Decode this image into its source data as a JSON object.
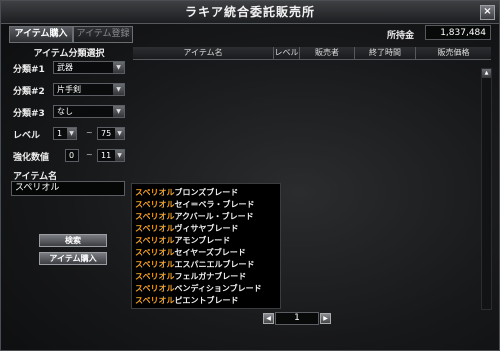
{
  "window": {
    "title": "ラキア統合委託販売所",
    "close": "×"
  },
  "tabs": [
    {
      "label": "アイテム購入"
    },
    {
      "label": "アイテム登録"
    }
  ],
  "gold": {
    "label": "所持金",
    "value": "1,837,484"
  },
  "filter": {
    "title": "アイテム分類選択",
    "cat1": {
      "label": "分類#1",
      "value": "武器"
    },
    "cat2": {
      "label": "分類#2",
      "value": "片手剣"
    },
    "cat3": {
      "label": "分類#3",
      "value": "なし"
    },
    "level": {
      "label": "レベル",
      "min": "1",
      "max": "75",
      "sep": "~"
    },
    "enhance": {
      "label": "強化数値",
      "min": "0",
      "max": "11",
      "sep": "~"
    },
    "name_label": "アイテム名",
    "name_value": "スペリオル"
  },
  "buttons": {
    "search": "検索",
    "buy": "アイテム購入"
  },
  "table": {
    "headers": [
      "アイテム名",
      "レベル",
      "販売者",
      "終了時間",
      "販売価格"
    ]
  },
  "suggestions": [
    {
      "prefix": "スペリオル",
      "rest": "ブロンズブレード"
    },
    {
      "prefix": "スペリオル",
      "rest": "セイ＝ベラ・ブレード"
    },
    {
      "prefix": "スペリオル",
      "rest": "アクバール・ブレード"
    },
    {
      "prefix": "スペリオル",
      "rest": "ヴィサヤブレード"
    },
    {
      "prefix": "スペリオル",
      "rest": "アモンブレード"
    },
    {
      "prefix": "スペリオル",
      "rest": "セイヤーズブレード"
    },
    {
      "prefix": "スペリオル",
      "rest": "エスパニエルブレード"
    },
    {
      "prefix": "スペリオル",
      "rest": "フェルガナブレード"
    },
    {
      "prefix": "スペリオル",
      "rest": "ベンディションブレード"
    },
    {
      "prefix": "スペリオル",
      "rest": "ピエントブレード"
    }
  ],
  "pager": {
    "page": "1",
    "prev": "◀",
    "next": "▶"
  },
  "icons": {
    "dropdown": "▼",
    "scroll_up": "▲"
  }
}
